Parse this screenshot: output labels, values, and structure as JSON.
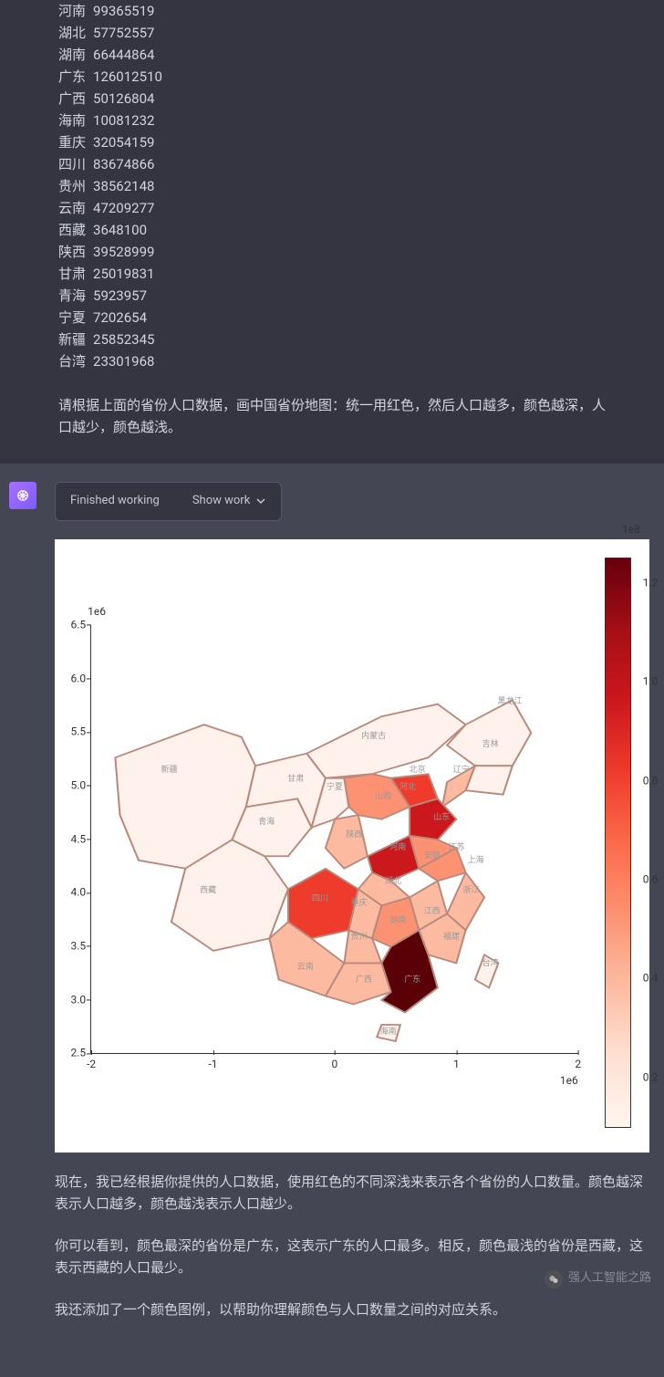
{
  "user_message": {
    "province_data": [
      {
        "name": "河南",
        "population": "99365519"
      },
      {
        "name": "湖北",
        "population": "57752557"
      },
      {
        "name": "湖南",
        "population": "66444864"
      },
      {
        "name": "广东",
        "population": "126012510"
      },
      {
        "name": "广西",
        "population": "50126804"
      },
      {
        "name": "海南",
        "population": "10081232"
      },
      {
        "name": "重庆",
        "population": "32054159"
      },
      {
        "name": "四川",
        "population": "83674866"
      },
      {
        "name": "贵州",
        "population": "38562148"
      },
      {
        "name": "云南",
        "population": "47209277"
      },
      {
        "name": "西藏",
        "population": "3648100"
      },
      {
        "name": "陕西",
        "population": "39528999"
      },
      {
        "name": "甘肃",
        "population": "25019831"
      },
      {
        "name": "青海",
        "population": "5923957"
      },
      {
        "name": "宁夏",
        "population": "7202654"
      },
      {
        "name": "新疆",
        "population": "25852345"
      },
      {
        "name": "台湾",
        "population": "23301968"
      }
    ],
    "prompt": "请根据上面的省份人口数据，画中国省份地图：统一用红色，然后人口越多，颜色越深，人口越少，颜色越浅。"
  },
  "assistant": {
    "status_label": "Finished working",
    "show_work_label": "Show work",
    "reply_paragraphs": [
      "现在，我已经根据你提供的人口数据，使用红色的不同深浅来表示各个省份的人口数量。颜色越深表示人口越多，颜色越浅表示人口越少。",
      "你可以看到，颜色最深的省份是广东，这表示广东的人口最多。相反，颜色最浅的省份是西藏，这表示西藏的人口最少。",
      "我还添加了一个颜色图例，以帮助你理解颜色与人口数量之间的对应关系。"
    ]
  },
  "watermark": "强人工智能之路",
  "chart_data": {
    "type": "choropleth-map",
    "region": "China provinces",
    "color_mapping": "Province population → red intensity (Reds colormap)",
    "y_axis": {
      "scale_label": "1e6",
      "ticks": [
        "2.5",
        "3.0",
        "3.5",
        "4.0",
        "4.5",
        "5.0",
        "5.5",
        "6.0",
        "6.5"
      ]
    },
    "x_axis": {
      "scale_label": "1e6",
      "ticks": [
        "-2",
        "-1",
        "0",
        "1",
        "2"
      ]
    },
    "colorbar": {
      "scale_label": "1e8",
      "ticks": [
        "0.2",
        "0.4",
        "0.6",
        "0.8",
        "1.0",
        "1.2"
      ]
    },
    "province_labels_on_map": [
      "黑龙江",
      "吉林",
      "辽宁",
      "内蒙古",
      "北京",
      "河北",
      "山西",
      "山东",
      "河南",
      "陕西",
      "宁夏",
      "甘肃",
      "青海",
      "新疆",
      "西藏",
      "四川",
      "重庆",
      "湖北",
      "安徽",
      "江苏",
      "上海",
      "浙江",
      "江西",
      "湖南",
      "贵州",
      "云南",
      "广西",
      "广东",
      "福建",
      "台湾",
      "海南"
    ]
  }
}
